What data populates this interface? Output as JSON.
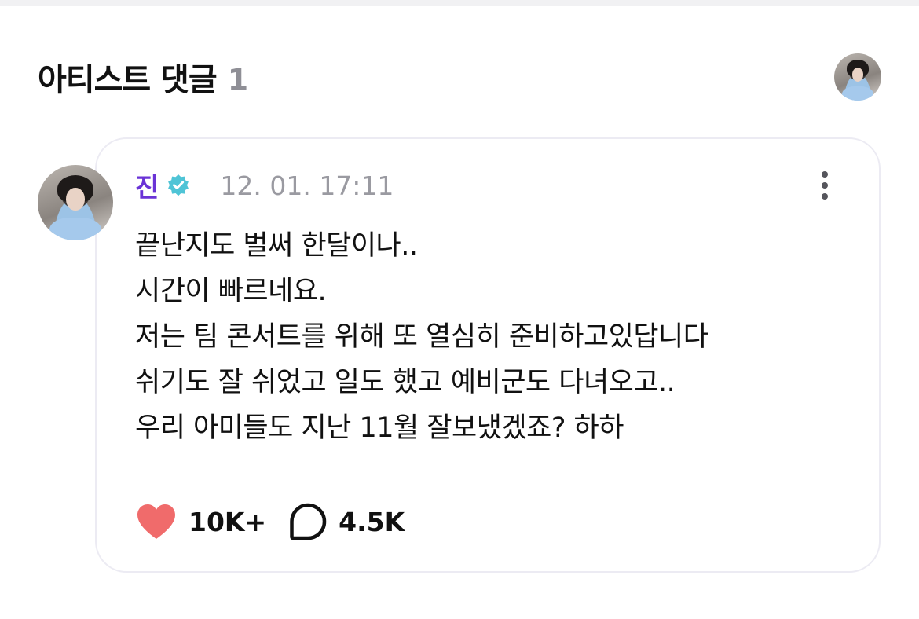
{
  "section": {
    "title": "아티스트 댓글",
    "count": "1"
  },
  "post": {
    "author": "진",
    "timestamp": "12. 01. 17:11",
    "lines": [
      "끝난지도 벌써 한달이나..",
      "시간이 빠르네요.",
      "저는 팀 콘서트를 위해 또 열심히 준비하고있답니다",
      "쉬기도 잘 쉬었고 일도 했고 예비군도 다녀오고..",
      "우리 아미들도 지난 11월 잘보냈겠죠? 하하"
    ],
    "likes": "10K+",
    "comments": "4.5K"
  },
  "colors": {
    "author_name": "#6a33d6",
    "verified_badge": "#4fc4d6",
    "like_heart": "#f06b6b",
    "count_gray": "#8f8f96",
    "card_border": "#ecebf3"
  },
  "icons": {
    "verified": "verified-check-badge",
    "like": "heart-icon",
    "comment": "speech-bubble-icon",
    "more": "vertical-dots-icon"
  }
}
